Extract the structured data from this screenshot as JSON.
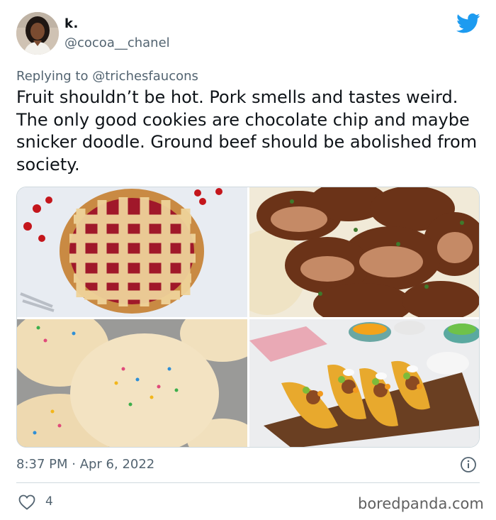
{
  "user": {
    "display_name": "k.",
    "handle": "@cocoa__chanel"
  },
  "reply": {
    "prefix": "Replying to",
    "mention": "@trichesfaucons"
  },
  "tweet": {
    "text": "Fruit shouldn’t be hot. Pork smells and tastes weird. The only good cookies are chocolate chip and maybe snicker doodle. Ground beef should be abolished from society."
  },
  "media": [
    {
      "subject": "cherry lattice pie"
    },
    {
      "subject": "sliced pork tenderloin"
    },
    {
      "subject": "sprinkle sugar cookies"
    },
    {
      "subject": "ground beef tacos"
    }
  ],
  "meta": {
    "timestamp": "8:37 PM · Apr 6, 2022"
  },
  "actions": {
    "like_count": "4"
  },
  "watermark": "boredpanda.com",
  "colors": {
    "twitter_blue": "#1d9bf0",
    "text_primary": "#0f1419",
    "text_secondary": "#536471",
    "divider": "#cfd9de"
  },
  "icons": [
    "twitter-bird-icon",
    "info-icon",
    "heart-icon"
  ]
}
